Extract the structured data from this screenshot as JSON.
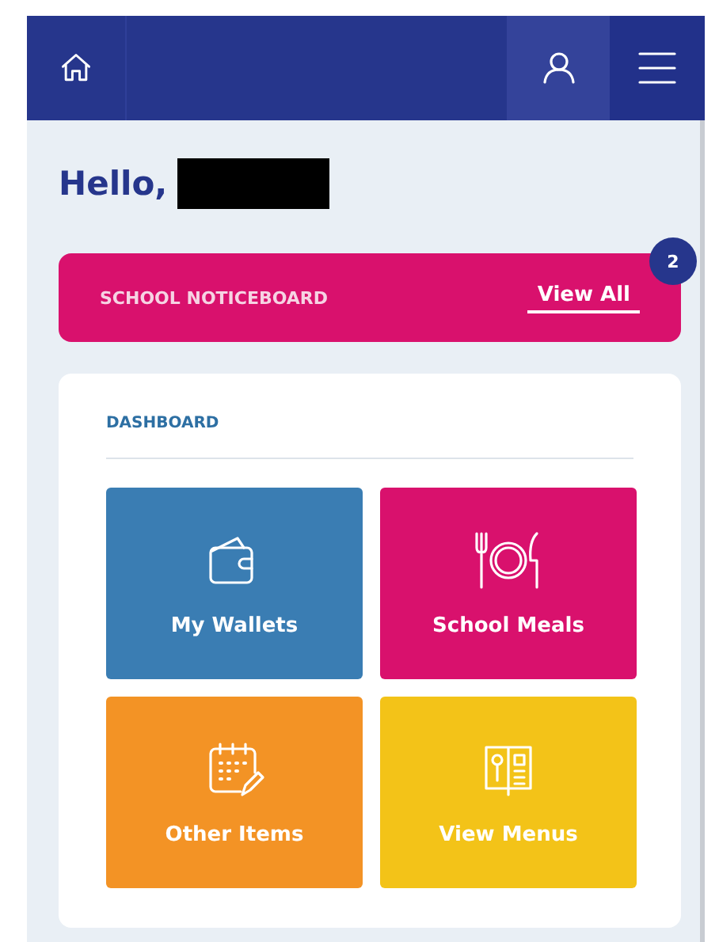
{
  "header": {
    "buttons": [
      {
        "kind": "home"
      },
      {
        "kind": "account"
      },
      {
        "kind": "menu"
      }
    ]
  },
  "greeting": {
    "text": "Hello,",
    "name_redacted": true
  },
  "noticeboard": {
    "title": "SCHOOL NOTICEBOARD",
    "link": "View All",
    "count": "2"
  },
  "dashboard": {
    "title": "DASHBOARD",
    "tiles": [
      {
        "label": "My Wallets",
        "kind": "wallet",
        "color": "#3a7db3"
      },
      {
        "label": "School Meals",
        "kind": "meals",
        "color": "#d9116d"
      },
      {
        "label": "Other Items",
        "kind": "calendar",
        "color": "#f39325"
      },
      {
        "label": "View Menus",
        "kind": "menu",
        "color": "#f3c318"
      }
    ]
  }
}
